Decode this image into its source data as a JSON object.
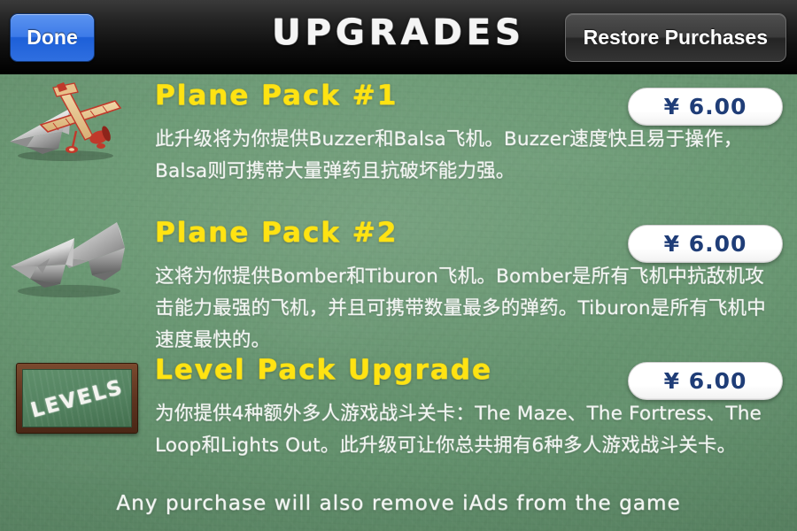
{
  "navbar": {
    "done_label": "Done",
    "title": "UPGRADES",
    "restore_label": "Restore Purchases"
  },
  "products": [
    {
      "icon": "paper-plane-and-balsa-plane-icon",
      "title": "Plane Pack #1",
      "description": "此升级将为你提供Buzzer和Balsa飞机。Buzzer速度快且易于操作，Balsa则可携带大量弹药且抗破坏能力强。",
      "price": "¥ 6.00"
    },
    {
      "icon": "two-paper-planes-icon",
      "title": "Plane Pack #2",
      "description": "这将为你提供Bomber和Tiburon飞机。Bomber是所有飞机中抗敌机攻击能力最强的飞机，并且可携带数量最多的弹药。Tiburon是所有飞机中速度最快的。",
      "price": "¥ 6.00"
    },
    {
      "icon": "levels-chalkboard-icon",
      "icon_text": "LEVELS",
      "title": "Level Pack Upgrade",
      "description": "为你提供4种额外多人游戏战斗关卡：The Maze、The Fortress、The Loop和Lights Out。此升级可让你总共拥有6种多人游戏战斗关卡。",
      "price": "¥ 6.00"
    }
  ],
  "footer": {
    "note": "Any purchase will also remove iAds from the game"
  },
  "colors": {
    "board_green": "#6d9b76",
    "title_yellow": "#ffe312",
    "price_navy": "#1f3d77",
    "done_blue": "#3d7ae8",
    "navbar_black": "#111111"
  }
}
